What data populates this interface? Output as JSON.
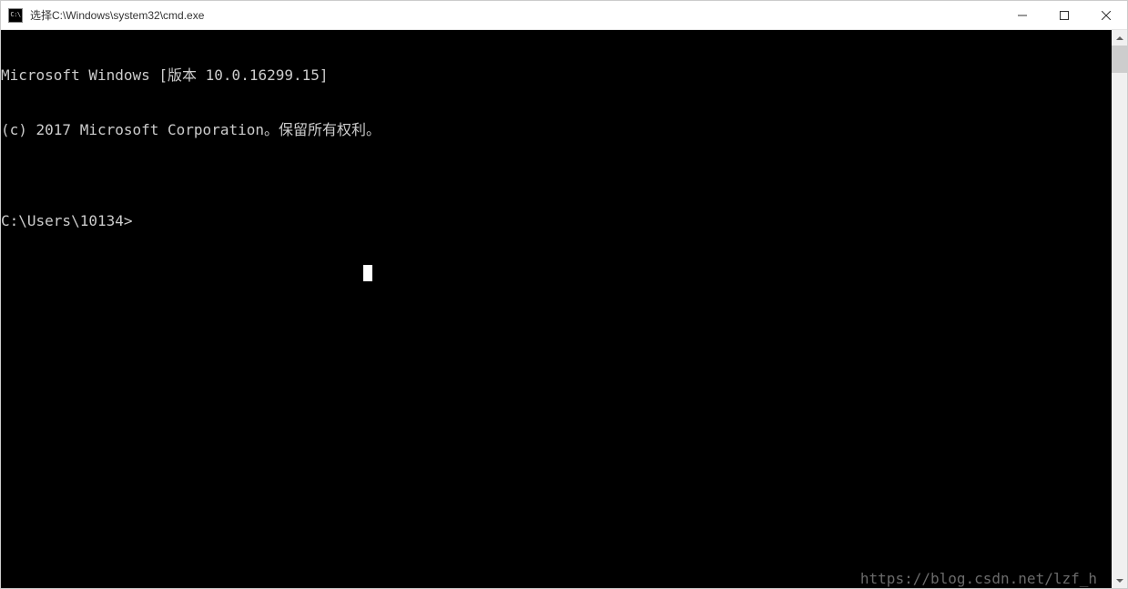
{
  "titlebar": {
    "icon_label": "C:\\",
    "title": "选择C:\\Windows\\system32\\cmd.exe"
  },
  "terminal": {
    "line1": "Microsoft Windows [版本 10.0.16299.15]",
    "line2": "(c) 2017 Microsoft Corporation。保留所有权利。",
    "blank": "",
    "prompt": "C:\\Users\\10134>"
  },
  "watermark": "https://blog.csdn.net/lzf_h"
}
